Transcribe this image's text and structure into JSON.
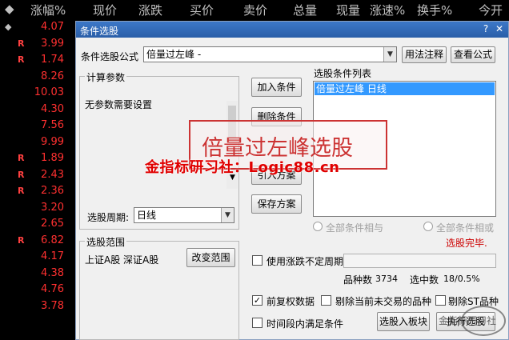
{
  "table": {
    "columns": [
      "涨幅%",
      "现价",
      "涨跌",
      "买价",
      "卖价",
      "总量",
      "现量",
      "涨速%",
      "换手%",
      "今开"
    ],
    "rows": [
      {
        "flag": "",
        "value": "4.07"
      },
      {
        "flag": "R",
        "value": "3.99"
      },
      {
        "flag": "R",
        "value": "1.74"
      },
      {
        "flag": "",
        "value": "8.26"
      },
      {
        "flag": "",
        "value": "10.03"
      },
      {
        "flag": "",
        "value": "4.30"
      },
      {
        "flag": "",
        "value": "7.56"
      },
      {
        "flag": "",
        "value": "9.99"
      },
      {
        "flag": "R",
        "value": "1.89"
      },
      {
        "flag": "R",
        "value": "2.43"
      },
      {
        "flag": "R",
        "value": "2.36"
      },
      {
        "flag": "",
        "value": "3.20"
      },
      {
        "flag": "",
        "value": "2.65"
      },
      {
        "flag": "R",
        "value": "6.82"
      },
      {
        "flag": "",
        "value": "4.17"
      },
      {
        "flag": "",
        "value": "4.38"
      },
      {
        "flag": "",
        "value": "4.76"
      },
      {
        "flag": "",
        "value": "3.78"
      }
    ]
  },
  "dialog": {
    "title": "条件选股",
    "formula_label": "条件选股公式",
    "formula_value": "倍量过左峰      -",
    "usage_button": "用法注释",
    "view_formula_button": "查看公式",
    "params_group": "计算参数",
    "params_text": "无参数需要设置",
    "add_condition": "加入条件",
    "delete_condition": "删除条件",
    "import_plan": "引入方案",
    "save_plan": "保存方案",
    "condition_list_label": "选股条件列表",
    "condition_items": [
      "倍量过左峰    日线"
    ],
    "period_label": "选股周期:",
    "period_value": "日线",
    "all_and": "全部条件相与",
    "all_or": "全部条件相或",
    "status": "选股完毕.",
    "range_group": "选股范围",
    "range_text": "上证A股  深证A股",
    "change_range": "改变范围",
    "use_irregular": "使用涨跌不定周期",
    "count_label": "品种数",
    "count_value": "3734",
    "selected_label": "选中数",
    "selected_value": "18/0.5%",
    "pre_adjust": "前复权数据",
    "exclude_untraded": "剔除当前未交易的品种",
    "exclude_st": "剔除ST品种",
    "time_condition": "时间段内满足条件",
    "select_into_block": "选股入板块",
    "execute": "执行选股"
  },
  "overlay": {
    "title": "倍量过左峰选股",
    "watermark": "金指标研习社：Logic88.cn",
    "logo": "金指标研习社"
  },
  "colors": {
    "up": "#ff3030",
    "title_bar": "#2a5ea8",
    "selection": "#3399ff",
    "overlay_red": "#cc3333"
  }
}
